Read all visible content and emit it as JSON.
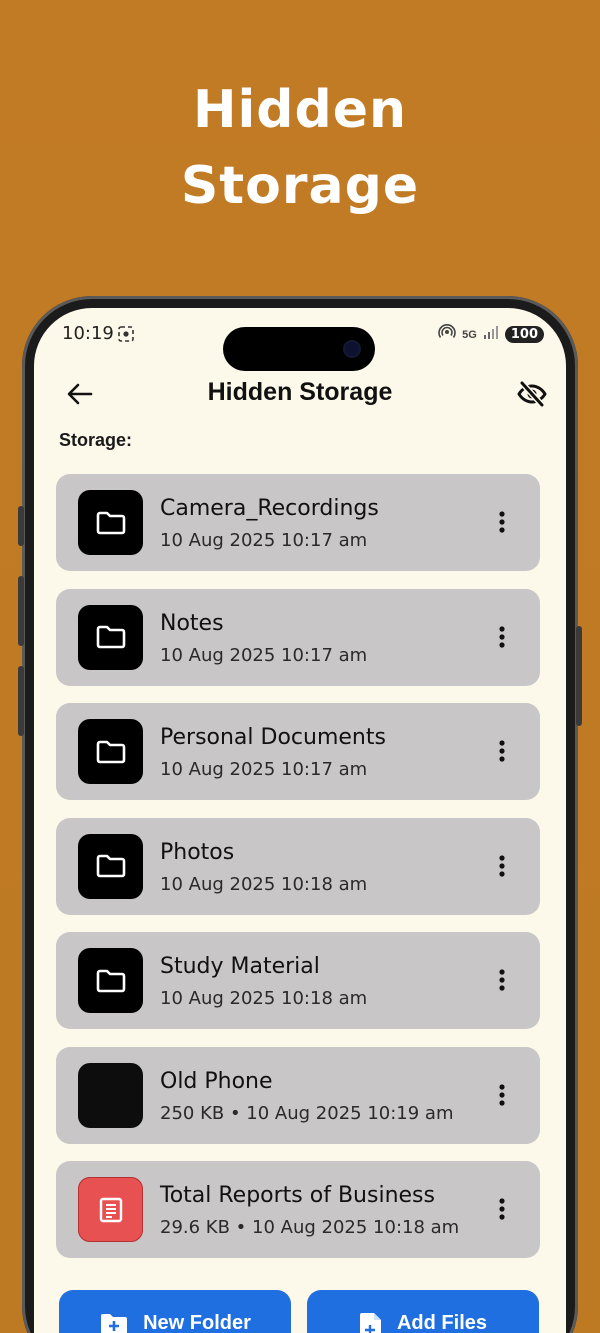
{
  "promo": {
    "title_line1": "Hidden",
    "title_line2": "Storage"
  },
  "status_bar": {
    "time": "10:19",
    "network": "5G",
    "battery": "100"
  },
  "header": {
    "title": "Hidden Storage",
    "back_icon": "arrow-left-icon",
    "hide_icon": "eye-off-icon"
  },
  "section_label": "Storage:",
  "items": [
    {
      "name": "Camera_Recordings",
      "meta": "10 Aug 2025 10:17 am",
      "kind": "folder"
    },
    {
      "name": "Notes",
      "meta": "10 Aug 2025 10:17 am",
      "kind": "folder"
    },
    {
      "name": "Personal Documents",
      "meta": "10 Aug 2025 10:17 am",
      "kind": "folder"
    },
    {
      "name": "Photos",
      "meta": "10 Aug 2025 10:18 am",
      "kind": "folder"
    },
    {
      "name": "Study Material",
      "meta": "10 Aug 2025 10:18 am",
      "kind": "folder"
    },
    {
      "name": "Old Phone",
      "meta": "250 KB • 10 Aug 2025 10:19 am",
      "kind": "image"
    },
    {
      "name": "Total Reports of Business",
      "meta": "29.6 KB • 10 Aug 2025 10:18 am",
      "kind": "document"
    }
  ],
  "actions": {
    "new_folder": "New Folder",
    "add_files": "Add Files"
  },
  "colors": {
    "background": "#c27b25",
    "screen": "#fcf8ea",
    "card": "#c8c6c7",
    "accent": "#1f6fe0",
    "doc_red": "#e85151"
  }
}
